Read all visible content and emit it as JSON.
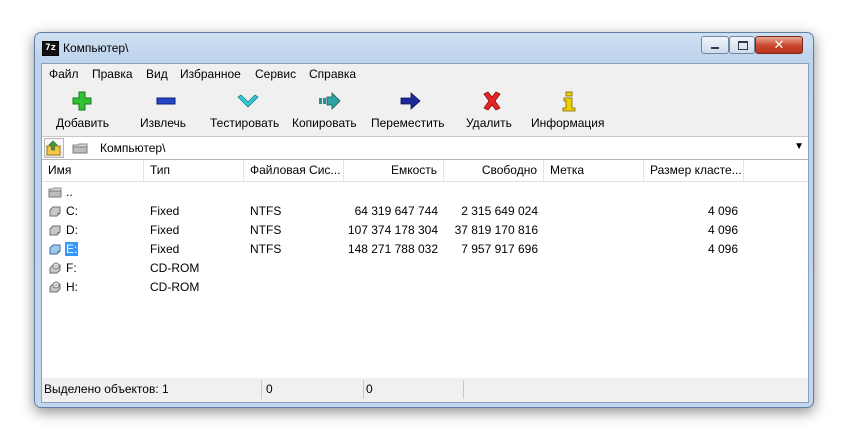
{
  "window": {
    "title": "Компьютер\\",
    "icon_text": "7z"
  },
  "menu": [
    "Файл",
    "Правка",
    "Вид",
    "Избранное",
    "Сервис",
    "Справка"
  ],
  "toolbar": [
    {
      "label": "Добавить",
      "icon": "plus-icon",
      "color": "#2fb52f"
    },
    {
      "label": "Извлечь",
      "icon": "minus-icon",
      "color": "#1f3fb0"
    },
    {
      "label": "Тестировать",
      "icon": "check-icon",
      "color": "#29b9c8"
    },
    {
      "label": "Копировать",
      "icon": "copy-arrow-icon",
      "color": "#2c8c8c"
    },
    {
      "label": "Переместить",
      "icon": "move-arrow-icon",
      "color": "#1a237e"
    },
    {
      "label": "Удалить",
      "icon": "delete-x-icon",
      "color": "#e02020"
    },
    {
      "label": "Информация",
      "icon": "info-icon",
      "color": "#e6c000"
    }
  ],
  "address": {
    "path": "Компьютер\\",
    "icon": "folder-icon"
  },
  "columns": [
    "Имя",
    "Тип",
    "Файловая Сис...",
    "Емкость",
    "Свободно",
    "Метка",
    "Размер класте..."
  ],
  "rows": [
    {
      "name": "..",
      "icon": "folder-up-icon",
      "type": "",
      "fs": "",
      "capacity": "",
      "free": "",
      "label": "",
      "cluster": ""
    },
    {
      "name": "C:",
      "icon": "hard-drive-icon",
      "type": "Fixed",
      "fs": "NTFS",
      "capacity": "64 319 647 744",
      "free": "2 315 649 024",
      "label": "",
      "cluster": "4 096"
    },
    {
      "name": "D:",
      "icon": "hard-drive-icon",
      "type": "Fixed",
      "fs": "NTFS",
      "capacity": "107 374 178 304",
      "free": "37 819 170 816",
      "label": "",
      "cluster": "4 096"
    },
    {
      "name": "E:",
      "icon": "hard-drive-icon",
      "type": "Fixed",
      "fs": "NTFS",
      "capacity": "148 271 788 032",
      "free": "7 957 917 696",
      "label": "",
      "cluster": "4 096",
      "selected": true
    },
    {
      "name": "F:",
      "icon": "cd-rom-icon",
      "type": "CD-ROM",
      "fs": "",
      "capacity": "",
      "free": "",
      "label": "",
      "cluster": ""
    },
    {
      "name": "H:",
      "icon": "cd-rom-icon",
      "type": "CD-ROM",
      "fs": "",
      "capacity": "",
      "free": "",
      "label": "",
      "cluster": ""
    }
  ],
  "status": {
    "selected": "Выделено объектов: 1",
    "size": "0",
    "packed": "0"
  }
}
